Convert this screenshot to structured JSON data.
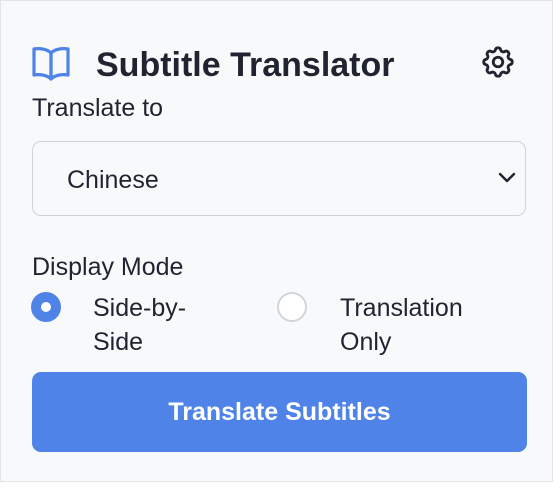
{
  "header": {
    "title": "Subtitle Translator",
    "book_icon": "book-open-icon",
    "settings_icon": "gear-icon"
  },
  "language": {
    "label": "Translate to",
    "selected": "Chinese"
  },
  "display_mode": {
    "label": "Display Mode",
    "options": [
      {
        "label": "Side-by-Side",
        "checked": true
      },
      {
        "label": "Translation Only",
        "checked": false
      }
    ]
  },
  "actions": {
    "translate_label": "Translate Subtitles"
  },
  "colors": {
    "accent": "#4f83e8",
    "text": "#1f2430",
    "background": "#f8f9fb"
  }
}
